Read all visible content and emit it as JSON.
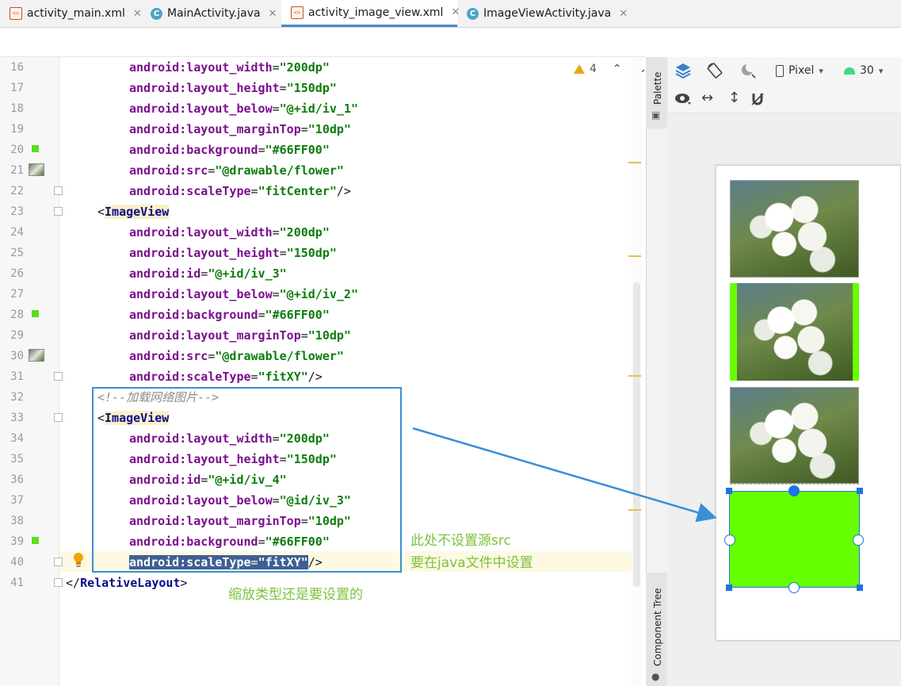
{
  "tabs": [
    {
      "label": "activity_main.xml",
      "icon": "xml-file-icon",
      "active": false
    },
    {
      "label": "MainActivity.java",
      "icon": "java-class-icon",
      "active": false
    },
    {
      "label": "activity_image_view.xml",
      "icon": "xml-file-icon",
      "active": true
    },
    {
      "label": "ImageViewActivity.java",
      "icon": "java-class-icon",
      "active": false
    }
  ],
  "editor": {
    "warning_count": "4",
    "line_numbers": [
      "16",
      "17",
      "18",
      "19",
      "20",
      "21",
      "22",
      "23",
      "24",
      "25",
      "26",
      "27",
      "28",
      "29",
      "30",
      "31",
      "32",
      "33",
      "34",
      "35",
      "36",
      "37",
      "38",
      "39",
      "40",
      "41"
    ],
    "lines": {
      "l16": {
        "attr": "android:layout_width",
        "val": "\"200dp\""
      },
      "l17": {
        "attr": "android:layout_height",
        "val": "\"150dp\""
      },
      "l18": {
        "attr": "android:layout_below",
        "val": "\"@+id/iv_1\""
      },
      "l19": {
        "attr": "android:layout_marginTop",
        "val": "\"10dp\""
      },
      "l20": {
        "attr": "android:background",
        "val": "\"#66FF00\""
      },
      "l21": {
        "attr": "android:src",
        "val": "\"@drawable/flower\""
      },
      "l22": {
        "attr": "android:scaleType",
        "val": "\"fitCenter\"",
        "tail": "/>"
      },
      "l23": {
        "open": "<",
        "tag": "ImageView"
      },
      "l24": {
        "attr": "android:layout_width",
        "val": "\"200dp\""
      },
      "l25": {
        "attr": "android:layout_height",
        "val": "\"150dp\""
      },
      "l26": {
        "attr": "android:id",
        "val": "\"@+id/iv_3\""
      },
      "l27": {
        "attr": "android:layout_below",
        "val": "\"@+id/iv_2\""
      },
      "l28": {
        "attr": "android:background",
        "val": "\"#66FF00\""
      },
      "l29": {
        "attr": "android:layout_marginTop",
        "val": "\"10dp\""
      },
      "l30": {
        "attr": "android:src",
        "val": "\"@drawable/flower\""
      },
      "l31": {
        "attr": "android:scaleType",
        "val": "\"fitXY\"",
        "tail": "/>"
      },
      "l32": {
        "comment": "<!--加载网络图片-->"
      },
      "l33": {
        "open": "<",
        "tag": "ImageView"
      },
      "l34": {
        "attr": "android:layout_width",
        "val": "\"200dp\""
      },
      "l35": {
        "attr": "android:layout_height",
        "val": "\"150dp\""
      },
      "l36": {
        "attr": "android:id",
        "val": "\"@+id/iv_4\""
      },
      "l37": {
        "attr": "android:layout_below",
        "val": "\"@id/iv_3\""
      },
      "l38": {
        "attr": "android:layout_marginTop",
        "val": "\"10dp\""
      },
      "l39": {
        "attr": "android:background",
        "val": "\"#66FF00\""
      },
      "l40": {
        "attr": "android:scaleType",
        "val": "\"fitXY\"",
        "tail": "/>"
      },
      "l41": {
        "close": "</",
        "tag": "RelativeLayout",
        "tail": ">"
      }
    }
  },
  "side_tabs": {
    "palette": "Palette",
    "component_tree": "Component Tree"
  },
  "design_toolbar": {
    "device": "Pixel",
    "api": "30"
  },
  "annotations": {
    "note1_line1": "此处不设置源src",
    "note1_line2": "要在java文件中设置",
    "note2": "缩放类型还是要设置的"
  },
  "colors": {
    "accent": "#3a8fd8",
    "image_bg": "#66FF00",
    "selection": "#3e5f93"
  }
}
